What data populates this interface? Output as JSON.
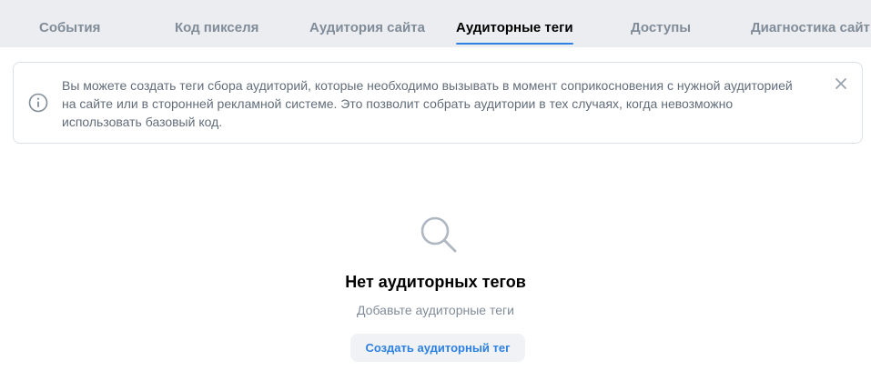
{
  "tabs": [
    {
      "label": "События",
      "active": false
    },
    {
      "label": "Код пикселя",
      "active": false
    },
    {
      "label": "Аудитория сайта",
      "active": false
    },
    {
      "label": "Аудиторные теги",
      "active": true
    },
    {
      "label": "Доступы",
      "active": false
    },
    {
      "label": "Диагностика сайт",
      "active": false
    }
  ],
  "notice": {
    "text": "Вы можете создать теги сбора аудиторий, которые необходимо вызывать в момент соприкосновения с нужной аудиторией на сайте или в сторонней рекламной системе. Это позволит собрать аудитории в тех случаях, когда невозможно использовать базовый код.",
    "icon": "info-icon",
    "close_icon": "close-icon"
  },
  "empty_state": {
    "icon": "search-icon",
    "title": "Нет аудиторных тегов",
    "subtitle": "Добавьте аудиторные теги",
    "button_label": "Создать аудиторный тег"
  },
  "colors": {
    "accent": "#2d81e0",
    "tabs_background": "#ebedf0",
    "muted_text": "#818c99",
    "notice_text": "#626d7a",
    "border": "#dce1e6",
    "button_background": "#f0f2f5"
  }
}
